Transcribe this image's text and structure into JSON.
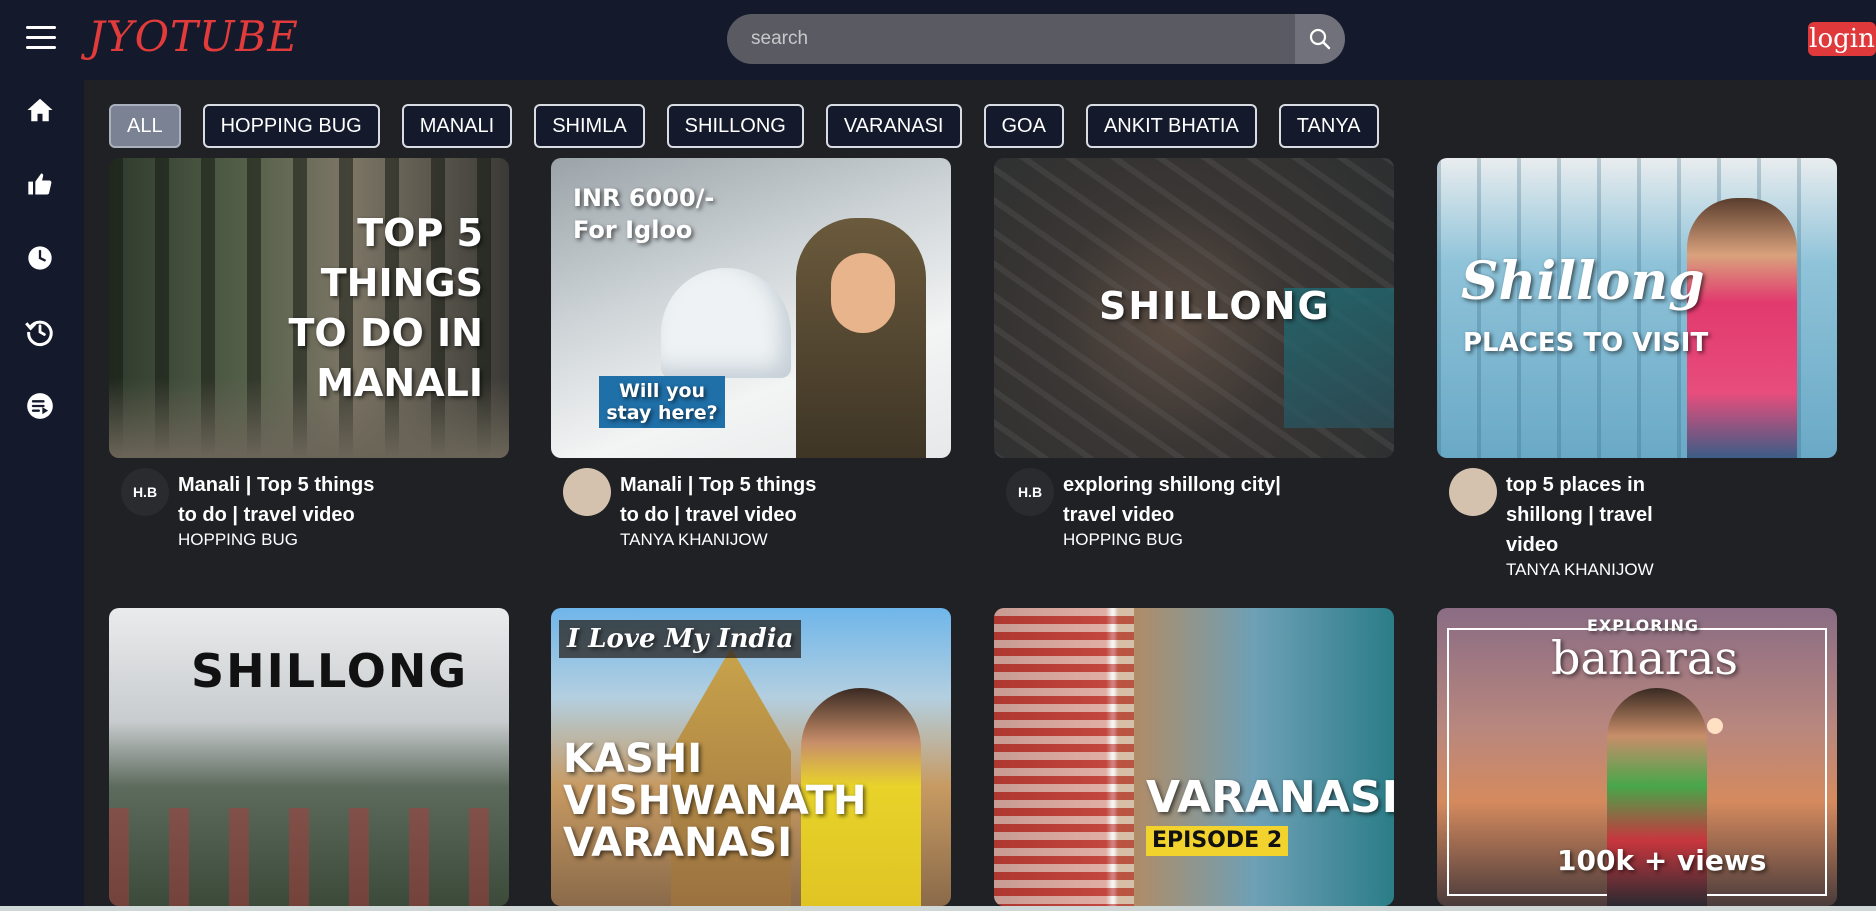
{
  "header": {
    "logo": "JYOTUBE",
    "search_placeholder": "search",
    "login_label": "login"
  },
  "sidebar": [
    {
      "name": "home-icon"
    },
    {
      "name": "thumbs-up-icon"
    },
    {
      "name": "clock-icon"
    },
    {
      "name": "history-icon"
    },
    {
      "name": "playlist-icon"
    }
  ],
  "chips": [
    "ALL",
    "HOPPING BUG",
    "MANALI",
    "SHIMLA",
    "SHILLONG",
    "VARANASI",
    "GOA",
    "ANKIT BHATIA",
    "TANYA"
  ],
  "videos": [
    {
      "title": "Manali | Top 5 things to do | travel video",
      "channel": "HOPPING BUG",
      "avatar": "H.B",
      "thumb_text": "TOP 5\nTHINGS\nTO DO IN\nMANALI"
    },
    {
      "title": "Manali | Top 5 things to do | travel video",
      "channel": "TANYA KHANIJOW",
      "avatar": "",
      "thumb_text": "INR 6000/-\nFor Igloo",
      "thumb_sub": "Will you stay here?"
    },
    {
      "title": "exploring shillong city| travel video",
      "channel": "HOPPING BUG",
      "avatar": "H.B",
      "thumb_text": "SHILLONG"
    },
    {
      "title": "top 5 places in shillong | travel video",
      "channel": "TANYA KHANIJOW",
      "avatar": "",
      "thumb_text": "Shillong",
      "thumb_sub": "PLACES TO VISIT"
    },
    {
      "title": "",
      "channel": "",
      "avatar": "",
      "thumb_text": "SHILLONG"
    },
    {
      "title": "",
      "channel": "",
      "avatar": "",
      "thumb_text": "KASHI\nVISHWANATH\nVARANASI",
      "thumb_sub": "I Love My India"
    },
    {
      "title": "",
      "channel": "",
      "avatar": "",
      "thumb_text": "VARANASI",
      "thumb_sub": "EPISODE 2"
    },
    {
      "title": "",
      "channel": "",
      "avatar": "",
      "thumb_text": "banaras",
      "thumb_sub": "EXPLORING",
      "thumb_extra": "100k + views"
    }
  ]
}
